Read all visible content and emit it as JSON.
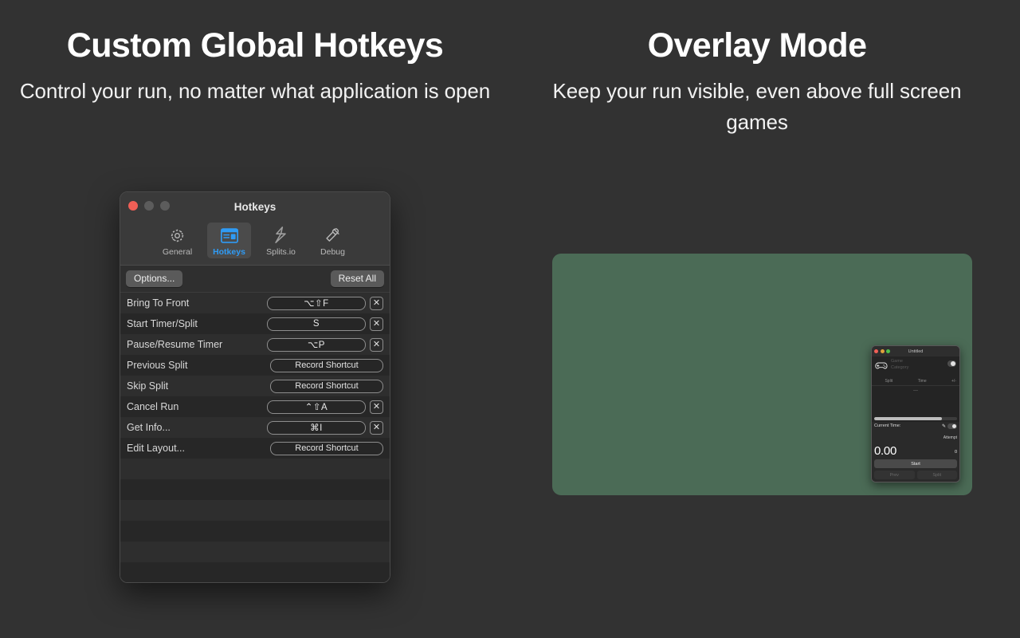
{
  "columns": {
    "left": {
      "headline": "Custom Global Hotkeys",
      "subhead": "Control your run, no matter what application is open"
    },
    "right": {
      "headline": "Overlay Mode",
      "subhead": "Keep your run visible, even above full screen games"
    }
  },
  "hotkeys_window": {
    "title": "Hotkeys",
    "toolbar": [
      {
        "label": "General",
        "icon": "gear-icon",
        "selected": false
      },
      {
        "label": "Hotkeys",
        "icon": "keyboard-window-icon",
        "selected": true
      },
      {
        "label": "Splits.io",
        "icon": "splits-io-icon",
        "selected": false
      },
      {
        "label": "Debug",
        "icon": "hammer-icon",
        "selected": false
      }
    ],
    "options_label": "Options...",
    "reset_label": "Reset All",
    "record_placeholder": "Record Shortcut",
    "clear_icon": "✕",
    "rows": [
      {
        "name": "Bring To Front",
        "shortcut": "⌥⇧F",
        "has_clear": true
      },
      {
        "name": "Start Timer/Split",
        "shortcut": "S",
        "has_clear": true
      },
      {
        "name": "Pause/Resume Timer",
        "shortcut": "⌥P",
        "has_clear": true
      },
      {
        "name": "Previous Split",
        "shortcut": "Record Shortcut",
        "has_clear": false
      },
      {
        "name": "Skip Split",
        "shortcut": "Record Shortcut",
        "has_clear": false
      },
      {
        "name": "Cancel Run",
        "shortcut": "⌃⇧A",
        "has_clear": true
      },
      {
        "name": "Get Info...",
        "shortcut": "⌘I",
        "has_clear": true
      },
      {
        "name": "Edit Layout...",
        "shortcut": "Record Shortcut",
        "has_clear": false
      }
    ]
  },
  "overlay": {
    "panel_color": "#4b6b56",
    "mini_window": {
      "title": "Untitled",
      "game_placeholder": "Game",
      "category_placeholder": "Category",
      "columns": {
        "split": "Split",
        "time": "Time",
        "delta": "+/-"
      },
      "empty_marker": "—",
      "current_time_label": "Current Time:",
      "current_time_value": "0.00",
      "attempt_label": "Attempt",
      "attempt_value": "0",
      "start_label": "Start",
      "prev_label": "Prev",
      "split_label": "Split"
    }
  },
  "theme": {
    "background": "#323232",
    "accent_blue": "#2f9bf5",
    "green": "#4b6b56",
    "text_primary": "#ffffff"
  }
}
